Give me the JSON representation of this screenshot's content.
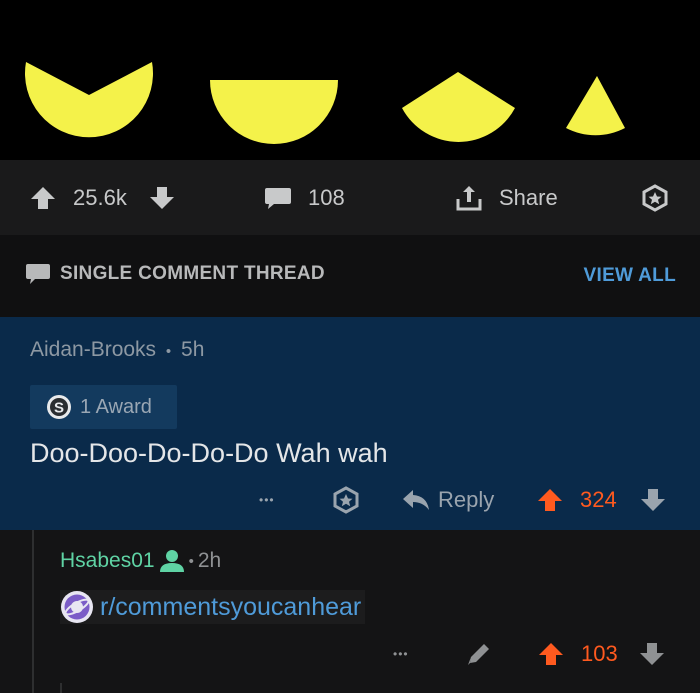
{
  "post": {
    "upvote_count": "25.6k",
    "comment_count": "108",
    "share_label": "Share"
  },
  "thread": {
    "title": "SINGLE COMMENT THREAD",
    "view_all_label": "VIEW ALL"
  },
  "comment1": {
    "author": "Aidan-Brooks",
    "separator": "•",
    "time": "5h",
    "award_label": "1 Award",
    "body": "Doo-Doo-Do-Do-Do Wah wah",
    "more_label": "•••",
    "reply_label": "Reply",
    "score": "324"
  },
  "comment2": {
    "author": "Hsabes01",
    "separator": "•",
    "time": "2h",
    "link_text": "r/commentsyoucanhear",
    "more_label": "•••",
    "score": "103"
  },
  "colors": {
    "accent_blue": "#4f9bd9",
    "upvoted_orange": "#ff5a1f",
    "highlight_bg": "#0a2a4a",
    "op_green": "#5fd3a4",
    "pacman_yellow": "#f4f24a"
  },
  "icons": {
    "upvote": "up-arrow-icon",
    "downvote": "down-arrow-icon",
    "comment": "speech-bubble-icon",
    "share": "share-icon",
    "award": "award-icon",
    "reply": "reply-arrow-icon",
    "edit": "pencil-icon",
    "op": "person-icon",
    "subreddit": "planet-icon"
  }
}
